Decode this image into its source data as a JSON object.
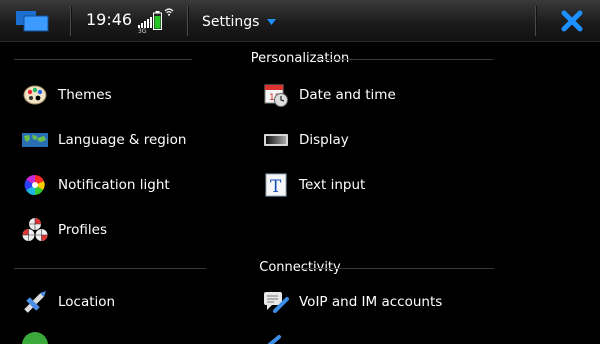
{
  "statusbar": {
    "time": "19:46",
    "network": "3G",
    "menu_title": "Settings",
    "icons": [
      "task-switcher-icon",
      "signal-icon",
      "battery-icon",
      "wifi-icon",
      "dropdown-arrow-icon",
      "close-icon"
    ]
  },
  "sections": [
    {
      "title": "Personalization",
      "items": [
        {
          "label": "Themes",
          "icon": "themes-palette-icon"
        },
        {
          "label": "Date and time",
          "icon": "calendar-clock-icon"
        },
        {
          "label": "Language & region",
          "icon": "world-map-icon"
        },
        {
          "label": "Display",
          "icon": "display-icon"
        },
        {
          "label": "Notification light",
          "icon": "color-wheel-icon"
        },
        {
          "label": "Text input",
          "icon": "text-input-icon"
        },
        {
          "label": "Profiles",
          "icon": "profiles-icon"
        }
      ]
    },
    {
      "title": "Connectivity",
      "items": [
        {
          "label": "Location",
          "icon": "location-satellite-icon"
        },
        {
          "label": "VoIP and IM accounts",
          "icon": "voip-im-icon"
        }
      ]
    }
  ],
  "colors": {
    "accent_blue": "#1e8fff",
    "background": "#000000"
  }
}
